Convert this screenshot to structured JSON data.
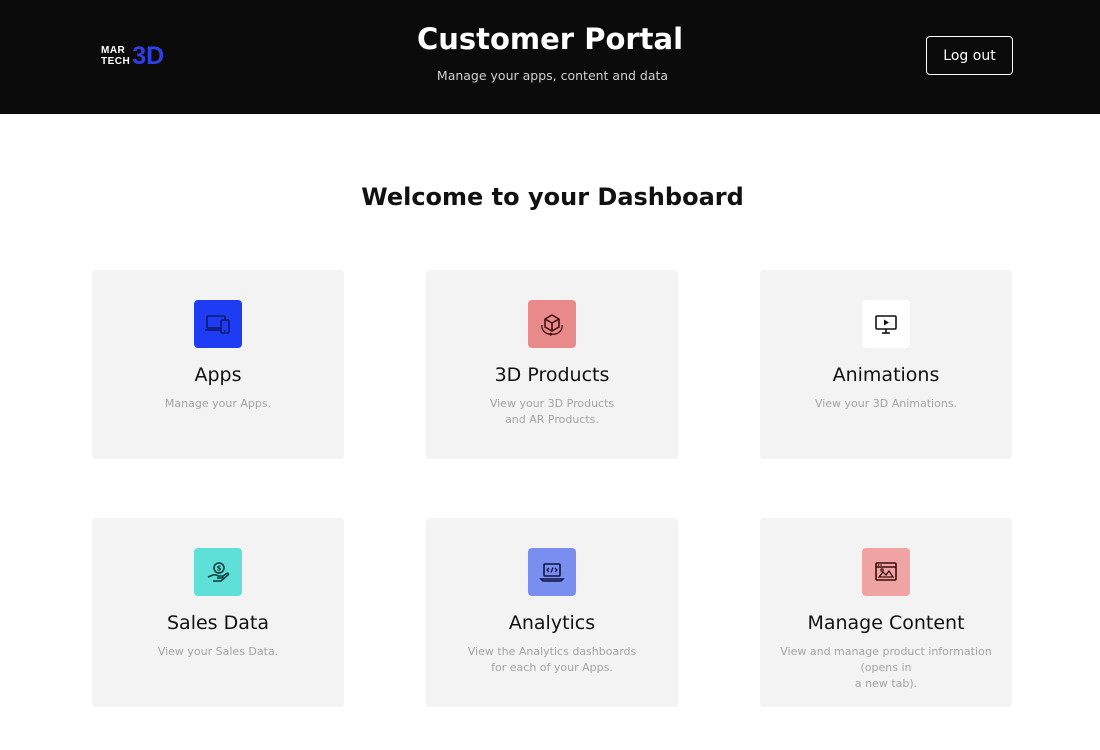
{
  "header": {
    "logo": {
      "line1": "MAR",
      "line2": "TECH",
      "accent": "3D"
    },
    "title": "Customer Portal",
    "subtitle": "Manage your apps, content and data",
    "logout_label": "Log out"
  },
  "main": {
    "welcome": "Welcome to your Dashboard",
    "cards": [
      {
        "title": "Apps",
        "desc_line1": "Manage your Apps.",
        "desc_line2": "",
        "icon": "devices-icon",
        "icon_bg": "#1f3cf5"
      },
      {
        "title": "3D Products",
        "desc_line1": "View your 3D Products",
        "desc_line2": "and AR Products.",
        "icon": "3d-cube-icon",
        "icon_bg": "#e88a8a"
      },
      {
        "title": "Animations",
        "desc_line1": "View your 3D Animations.",
        "desc_line2": "",
        "icon": "monitor-play-icon",
        "icon_bg": "#ffffff"
      },
      {
        "title": "Sales Data",
        "desc_line1": "View your Sales Data.",
        "desc_line2": "",
        "icon": "hand-coin-icon",
        "icon_bg": "#5ee0d8"
      },
      {
        "title": "Analytics",
        "desc_line1": "View the Analytics dashboards",
        "desc_line2": "for each of your Apps.",
        "icon": "laptop-code-icon",
        "icon_bg": "#7a8ef0"
      },
      {
        "title": "Manage Content",
        "desc_line1": "View and manage product information (opens in",
        "desc_line2": "a new tab).",
        "icon": "browser-image-icon",
        "icon_bg": "#f0a3a3"
      }
    ]
  }
}
